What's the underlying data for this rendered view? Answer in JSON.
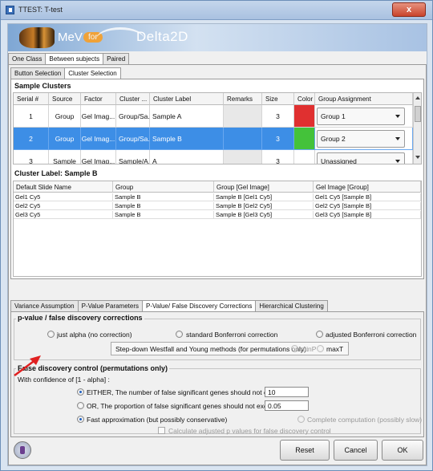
{
  "window": {
    "title": "TTEST: T-test",
    "close_label": "x"
  },
  "banner": {
    "mev": "MeV",
    "for": "for",
    "product": "Delta2D"
  },
  "top_tabs": [
    "One Class",
    "Between subjects",
    "Paired"
  ],
  "sub_tabs": [
    "Button Selection",
    "Cluster Selection"
  ],
  "sample_clusters": {
    "title": "Sample Clusters",
    "headers": [
      "Serial #",
      "Source",
      "Factor",
      "Cluster ...",
      "Cluster Label",
      "Remarks",
      "Size",
      "Color",
      "Group Assignment"
    ],
    "rows": [
      {
        "serial": "1",
        "source": "Group",
        "factor": "Gel Imag...",
        "cluster": "Group/Sa...",
        "label": "Sample A",
        "remarks": "",
        "size": "3",
        "color": "#e03030",
        "group": "Group 1"
      },
      {
        "serial": "2",
        "source": "Group",
        "factor": "Gel Imag...",
        "cluster": "Group/Sa...",
        "label": "Sample B",
        "remarks": "",
        "size": "3",
        "color": "#44c23a",
        "group": "Group 2"
      },
      {
        "serial": "3",
        "source": "Sample",
        "factor": "Gel Imag...",
        "cluster": "Sample/A...",
        "label": "A",
        "remarks": "",
        "size": "3",
        "color": "#ffffff",
        "group": "Unassigned"
      }
    ]
  },
  "cluster_label": {
    "title": "Cluster Label: Sample B",
    "headers": [
      "Default Slide Name",
      "Group",
      "Group [Gel Image]",
      "Gel Image [Group]"
    ],
    "rows": [
      [
        "Gel1 Cy5",
        "Sample B",
        "Sample B [Gel1 Cy5]",
        "Gel1 Cy5 [Sample B]"
      ],
      [
        "Gel2 Cy5",
        "Sample B",
        "Sample B [Gel2 Cy5]",
        "Gel2 Cy5 [Sample B]"
      ],
      [
        "Gel3 Cy5",
        "Sample B",
        "Sample B [Gel3 Cy5]",
        "Gel3 Cy5 [Sample B]"
      ]
    ]
  },
  "bottom_tabs": [
    "Variance Assumption",
    "P-Value Parameters",
    "P-Value/ False Discovery Corrections",
    "Hierarchical Clustering"
  ],
  "pvalue": {
    "title": "p-value / false discovery corrections",
    "just_alpha": "just alpha (no correction)",
    "std_bonf": "standard Bonferroni correction",
    "adj_bonf": "adjusted Bonferroni correction",
    "westfall": "Step-down Westfall and Young methods (for permutations only):",
    "minP": "minP",
    "maxT": "maxT"
  },
  "fdc": {
    "title": "False discovery control (permutations only)",
    "confidence": "With confidence of [1 - alpha] :",
    "either": "EITHER, The number of false significant genes should not exceed",
    "either_value": "10",
    "or": "OR, The proportion of false significant genes should not exceed",
    "or_value": "0.05",
    "fast": "Fast approximation (but possibly conservative)",
    "complete": "Complete computation (possibly slow)",
    "calc_adj": "Calculate adjusted p values for false discovery control"
  },
  "buttons": {
    "reset": "Reset",
    "cancel": "Cancel",
    "ok": "OK"
  },
  "colors": {
    "selection": "#3d8ee6",
    "arrow": "#e02020"
  }
}
